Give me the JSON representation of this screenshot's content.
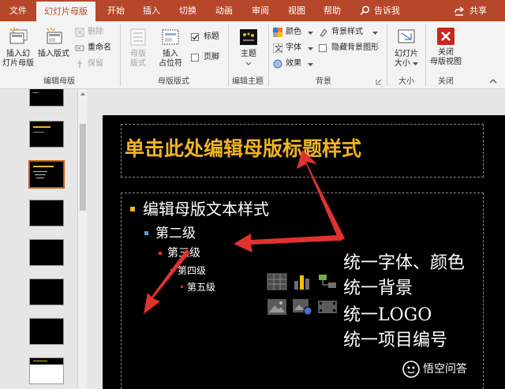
{
  "tabs": {
    "file": "文件",
    "slide_master": "幻灯片母版",
    "home": "开始",
    "insert": "插入",
    "transitions": "切换",
    "animations": "动画",
    "review": "审阅",
    "view": "视图",
    "help": "帮助"
  },
  "tell_me": "告诉我",
  "share": "共享",
  "ribbon": {
    "insert_slide_master": "插入幻",
    "insert_slide_master_2": "灯片母版",
    "insert_layout": "插入版式",
    "delete": "删除",
    "rename": "重命名",
    "preserve": "保留",
    "group_edit_master": "编辑母版",
    "master_layout": "母版",
    "master_layout_2": "版式",
    "insert_placeholder": "插入",
    "insert_placeholder_2": "占位符",
    "title_checkbox": "标题",
    "footer_checkbox": "页脚",
    "group_master_layout": "母版版式",
    "themes": "主题",
    "group_edit_theme": "编辑主题",
    "colors": "颜色",
    "fonts": "字体",
    "effects": "效果",
    "background_styles": "背景样式",
    "hide_background_graphics": "隐藏背景图形",
    "group_background": "背景",
    "slide_size": "幻灯片",
    "slide_size_2": "大小",
    "group_size": "大小",
    "close_master_view": "关闭",
    "close_master_view_2": "母版视图",
    "group_close": "关闭"
  },
  "slide": {
    "title": "单击此处编辑母版标题样式",
    "level1": "编辑母版文本样式",
    "level2": "第二级",
    "level3": "第三级",
    "level4": "第四级",
    "level5": "第五级"
  },
  "notes": [
    "统一字体、颜色",
    "统一背景",
    "统一LOGO",
    "统一项目编号"
  ],
  "watermark": "悟空问答",
  "colors": {
    "accent": "#b7472a",
    "title": "#f0b422",
    "arrow": "#e0322e",
    "close_icon": "#c5281c"
  }
}
